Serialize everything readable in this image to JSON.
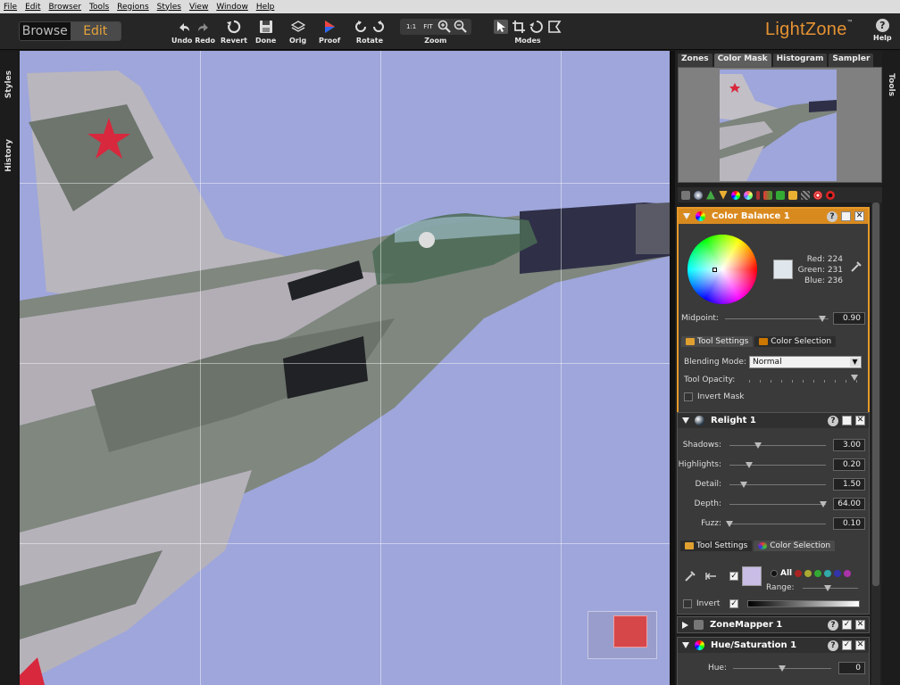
{
  "menu": [
    "File",
    "Edit",
    "Browser",
    "Tools",
    "Regions",
    "Styles",
    "View",
    "Window",
    "Help"
  ],
  "modes": {
    "browse": "Browse",
    "edit": "Edit"
  },
  "toolbar": {
    "undo_redo": "Undo Redo",
    "revert": "Revert",
    "done": "Done",
    "orig": "Orig",
    "proof": "Proof",
    "rotate": "Rotate",
    "zoom": "Zoom",
    "zoom_1to1": "1:1",
    "zoom_fit": "FIT",
    "modes": "Modes",
    "help": "Help"
  },
  "logo": {
    "name": "LightZone",
    "tm": "™"
  },
  "left_tabs": {
    "styles": "Styles",
    "history": "History"
  },
  "right_tabs": {
    "tools": "Tools"
  },
  "panel_tabs": [
    "Zones",
    "Color Mask",
    "Histogram",
    "Sampler"
  ],
  "color_balance": {
    "title": "Color Balance 1",
    "red_label": "Red:",
    "red": "224",
    "green_label": "Green:",
    "green": "231",
    "blue_label": "Blue:",
    "blue": "236",
    "midpoint_label": "Midpoint:",
    "midpoint": "0.90",
    "tab_settings": "Tool Settings",
    "tab_selection": "Color Selection",
    "blending_label": "Blending Mode:",
    "blending": "Normal",
    "opacity_label": "Tool Opacity:",
    "invert_mask": "Invert Mask"
  },
  "relight": {
    "title": "Relight 1",
    "shadows_label": "Shadows:",
    "shadows": "3.00",
    "shadows_level": 0.3,
    "highlights_label": "Highlights:",
    "highlights": "0.20",
    "highlights_level": 0.2,
    "detail_label": "Detail:",
    "detail": "1.50",
    "detail_level": 0.15,
    "depth_label": "Depth:",
    "depth": "64.00",
    "depth_level": 0.97,
    "fuzz_label": "Fuzz:",
    "fuzz": "0.10",
    "fuzz_level": 0.0,
    "tab_settings": "Tool Settings",
    "tab_selection": "Color Selection",
    "all": "All",
    "range": "Range:",
    "invert": "Invert"
  },
  "zonemapper": {
    "title": "ZoneMapper 1"
  },
  "hue_sat": {
    "title": "Hue/Saturation 1",
    "hue_label": "Hue:",
    "hue": "0"
  },
  "help_glyph": "?",
  "close_glyph": "✕",
  "check_glyph": "✓",
  "colors": {
    "accent": "#e59a2a",
    "sky": "#9ea6db",
    "panel": "#3a3a3a"
  }
}
